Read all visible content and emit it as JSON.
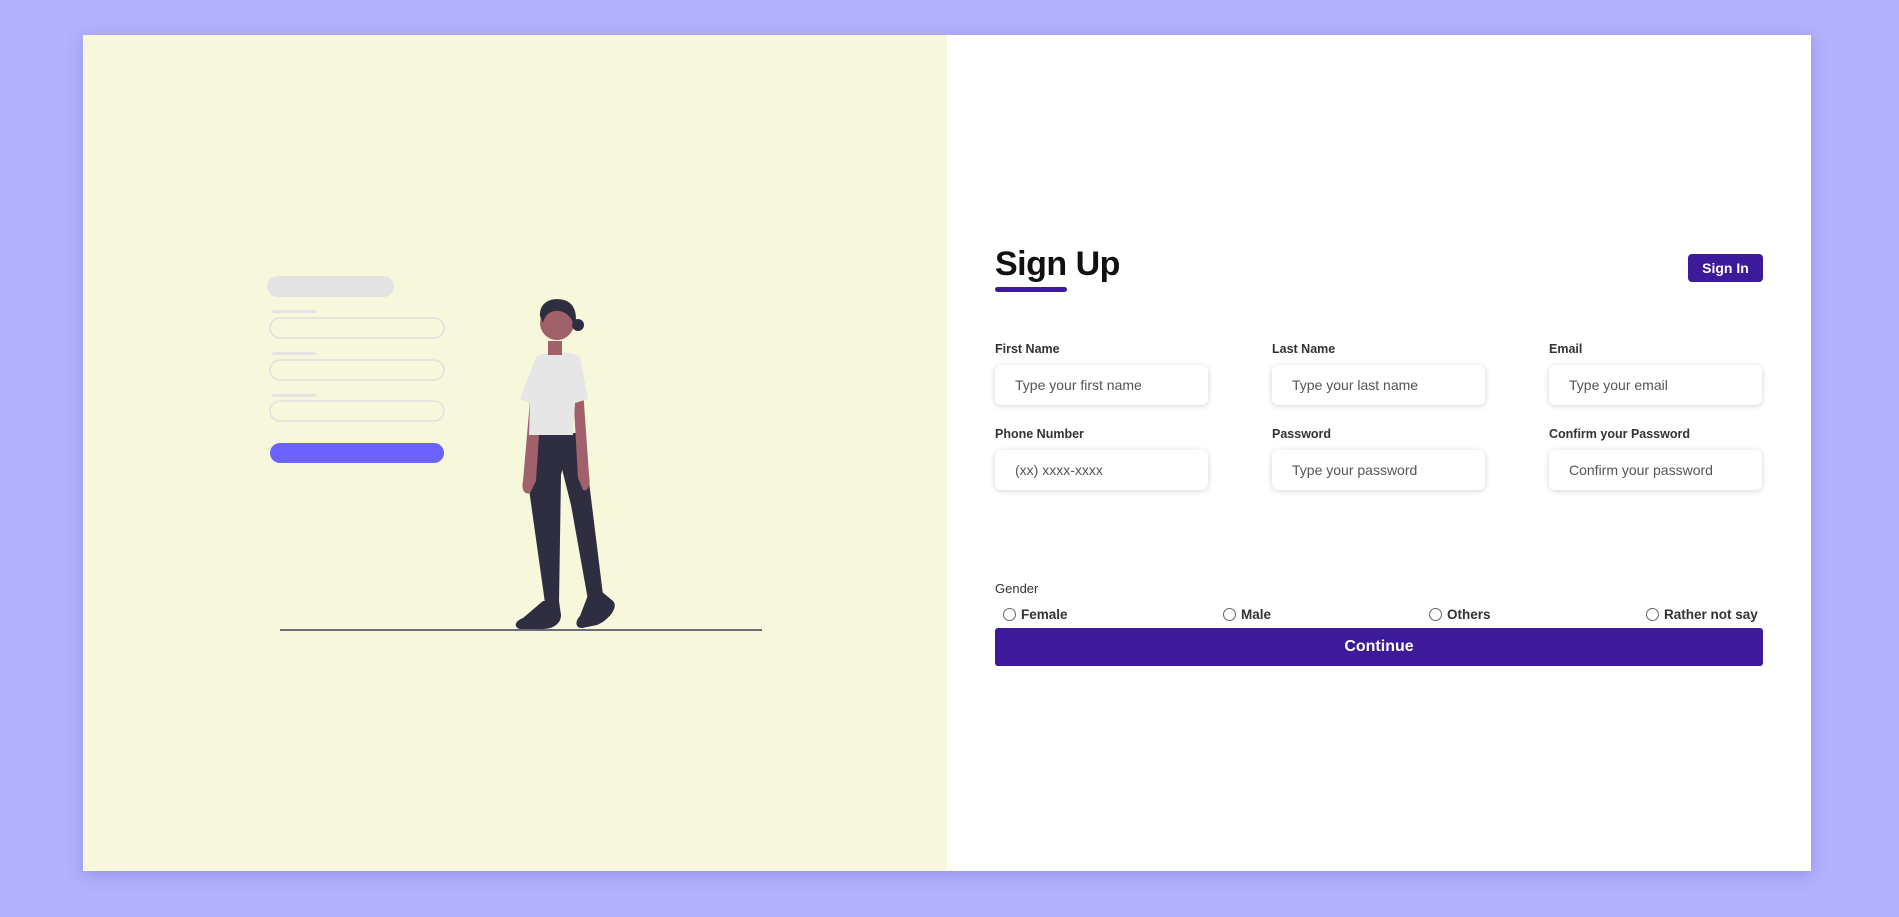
{
  "signup": {
    "title": "Sign Up",
    "signin_label": "Sign In",
    "fields": [
      {
        "label": "First Name",
        "placeholder": "Type your first name",
        "value": ""
      },
      {
        "label": "Last Name",
        "placeholder": "Type your last name",
        "value": ""
      },
      {
        "label": "Email",
        "placeholder": "Type your email",
        "value": ""
      },
      {
        "label": "Phone Number",
        "placeholder": "(xx) xxxx-xxxx",
        "value": ""
      },
      {
        "label": "Password",
        "placeholder": "Type your password",
        "value": ""
      },
      {
        "label": "Confirm your Password",
        "placeholder": "Confirm your password",
        "value": ""
      }
    ],
    "gender": {
      "label": "Gender",
      "options": [
        "Female",
        "Male",
        "Others",
        "Rather not say"
      ],
      "selected": null
    },
    "continue_label": "Continue"
  },
  "colors": {
    "page_background": "#b3b2ff",
    "illustration_background": "#f7f7dc",
    "accent": "#3d1a9a",
    "illustration_button": "#6c63ff",
    "figure_dark": "#2f2e41",
    "figure_skin": "#a0616a",
    "figure_shirt": "#e6e6e6"
  }
}
